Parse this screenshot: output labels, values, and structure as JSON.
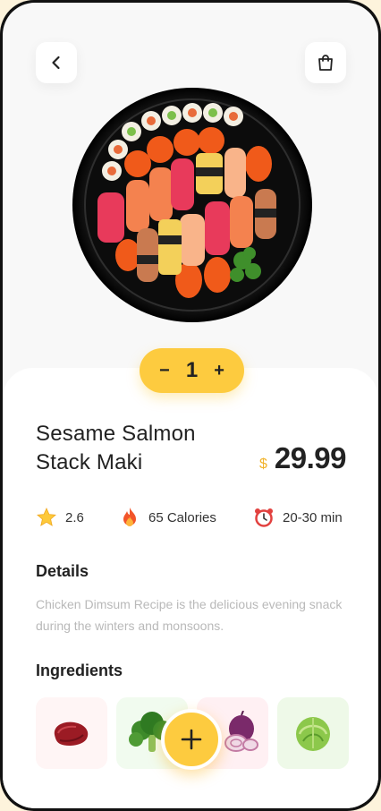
{
  "header": {
    "back_icon": "chevron-left-icon",
    "bag_icon": "shopping-bag-icon"
  },
  "product": {
    "image": "sushi-platter-image",
    "name_line1": "Sesame Salmon",
    "name_line2": "Stack Maki",
    "currency": "$",
    "price": "29.99"
  },
  "quantity": {
    "minus": "−",
    "value": "1",
    "plus": "+"
  },
  "stats": {
    "rating": "2.6",
    "calories": "65 Calories",
    "time": "20-30 min"
  },
  "details": {
    "title": "Details",
    "text": "Chicken Dimsum Recipe is the delicious evening snack during the winters and monsoons."
  },
  "ingredients": {
    "title": "Ingredients",
    "items": [
      "meat-icon",
      "broccoli-icon",
      "onion-icon",
      "cabbage-icon"
    ]
  },
  "actions": {
    "add_label": "+"
  },
  "colors": {
    "accent": "#fdcb3f",
    "price_currency": "#f2b32b",
    "text_dark": "#222222",
    "text_muted": "#b9b9b9"
  }
}
